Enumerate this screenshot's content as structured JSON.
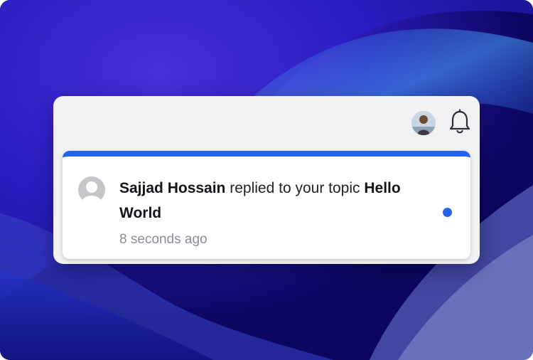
{
  "header": {
    "avatar_icon": "user-photo-avatar",
    "bell_icon": "bell-icon"
  },
  "notification": {
    "actor": "Sajjad Hossain",
    "action": "replied to your topic",
    "topic": "Hello World",
    "time": "8 seconds ago",
    "avatar_icon": "default-user-avatar-icon",
    "unread": true,
    "accent_color": "#2462e8"
  }
}
